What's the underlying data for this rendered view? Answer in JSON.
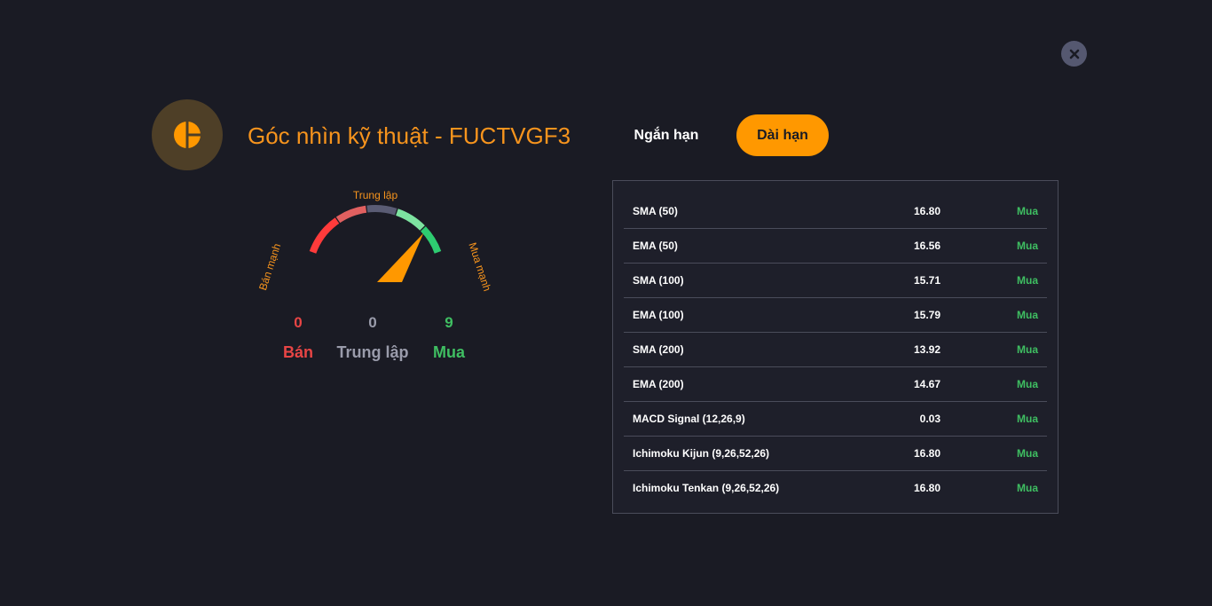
{
  "title": "Góc nhìn kỹ thuật - FUCTVGF3",
  "tabs": {
    "short_term": "Ngắn hạn",
    "long_term": "Dài hạn",
    "active": "long_term"
  },
  "gauge": {
    "labels": {
      "strong_sell": "Bán mạnh",
      "neutral": "Trung lập",
      "strong_buy": "Mua mạnh"
    },
    "needle_level": 0.85,
    "colors": {
      "strong_sell": "#ff3b3b",
      "sell": "#e06060",
      "neutral": "#5a5c74",
      "buy": "#7de3a0",
      "strong_buy": "#2ecc71",
      "needle": "#ff9800"
    }
  },
  "summary": {
    "sell": {
      "count": "0",
      "label": "Bán"
    },
    "neutral": {
      "count": "0",
      "label": "Trung lập"
    },
    "buy": {
      "count": "9",
      "label": "Mua"
    }
  },
  "indicators": [
    {
      "name": "SMA (50)",
      "value": "16.80",
      "action": "Mua"
    },
    {
      "name": "EMA (50)",
      "value": "16.56",
      "action": "Mua"
    },
    {
      "name": "SMA (100)",
      "value": "15.71",
      "action": "Mua"
    },
    {
      "name": "EMA (100)",
      "value": "15.79",
      "action": "Mua"
    },
    {
      "name": "SMA (200)",
      "value": "13.92",
      "action": "Mua"
    },
    {
      "name": "EMA (200)",
      "value": "14.67",
      "action": "Mua"
    },
    {
      "name": "MACD Signal (12,26,9)",
      "value": "0.03",
      "action": "Mua"
    },
    {
      "name": "Ichimoku Kijun (9,26,52,26)",
      "value": "16.80",
      "action": "Mua"
    },
    {
      "name": "Ichimoku Tenkan (9,26,52,26)",
      "value": "16.80",
      "action": "Mua"
    }
  ]
}
